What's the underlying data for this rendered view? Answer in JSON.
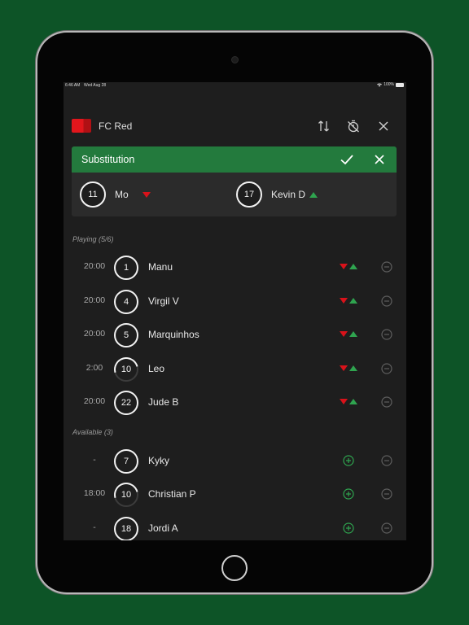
{
  "status_bar": {
    "time": "6:46 AM",
    "date": "Wed Aug 28",
    "battery": "100%"
  },
  "team": {
    "name": "FC Red"
  },
  "substitution": {
    "title": "Substitution",
    "out_player": {
      "number": "11",
      "name": "Mo"
    },
    "in_player": {
      "number": "17",
      "name": "Kevin D"
    }
  },
  "playing": {
    "label": "Playing (5/6)",
    "players": [
      {
        "time": "20:00",
        "number": "1",
        "name": "Manu"
      },
      {
        "time": "20:00",
        "number": "4",
        "name": "Virgil V"
      },
      {
        "time": "20:00",
        "number": "5",
        "name": "Marquinhos"
      },
      {
        "time": "2:00",
        "number": "10",
        "name": "Leo"
      },
      {
        "time": "20:00",
        "number": "22",
        "name": "Jude B"
      }
    ]
  },
  "available": {
    "label": "Available (3)",
    "players": [
      {
        "time": "-",
        "number": "7",
        "name": "Kyky"
      },
      {
        "time": "18:00",
        "number": "10",
        "name": "Christian P"
      },
      {
        "time": "-",
        "number": "18",
        "name": "Jordi A"
      }
    ]
  },
  "colors": {
    "accent": "#237a3d",
    "out_arrow": "#d9121a",
    "in_arrow": "#2fa44f",
    "background": "#0d5427"
  },
  "icons": {
    "sort": "sort-icon",
    "timer_off": "timer-off-icon",
    "close": "close-icon",
    "check": "check-icon",
    "swap": "swap-arrows-icon",
    "add": "add-circle-icon",
    "remove": "remove-circle-icon"
  }
}
